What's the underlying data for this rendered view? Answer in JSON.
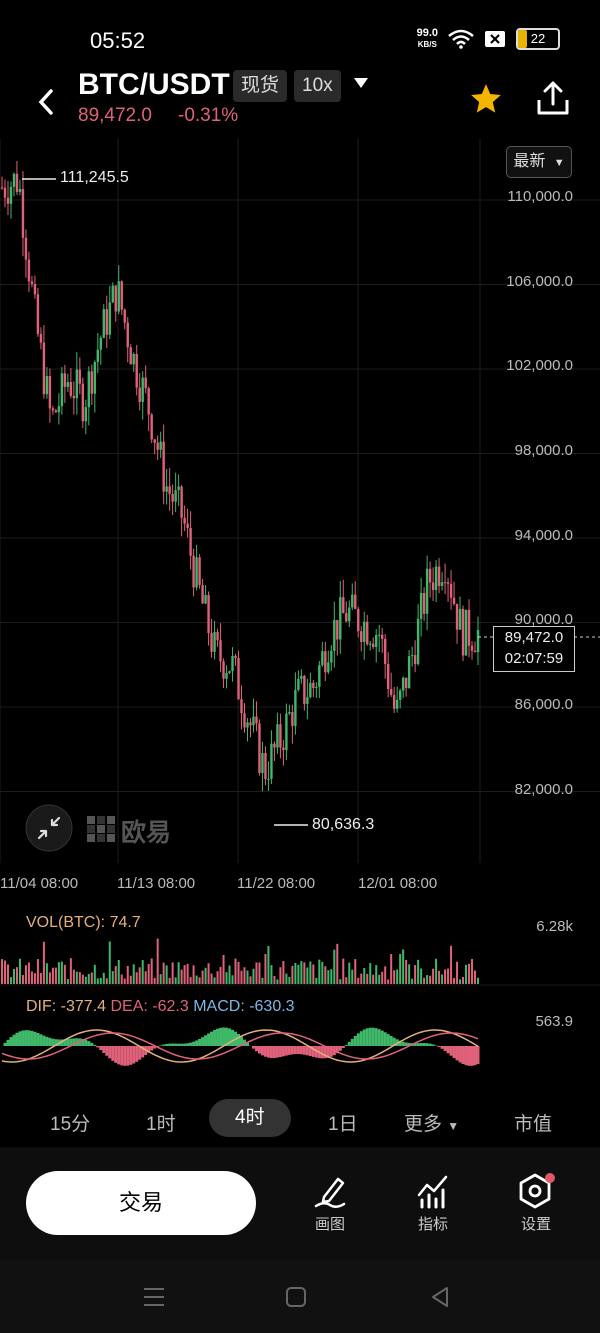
{
  "status_bar": {
    "time": "05:52",
    "net_speed_value": "99.0",
    "net_speed_unit": "KB/S",
    "battery": "22"
  },
  "header": {
    "pair": "BTC/USDT",
    "market_tag": "现货",
    "leverage_tag": "10x",
    "price": "89,472.0",
    "change": "-0.31%"
  },
  "chart": {
    "latest_button": "最新",
    "y_ticks": [
      "110,000.0",
      "106,000.0",
      "102,000.0",
      "98,000.0",
      "94,000.0",
      "90,000.0",
      "86,000.0",
      "82,000.0"
    ],
    "x_ticks": [
      "11/04 08:00",
      "11/13 08:00",
      "11/22 08:00",
      "12/01 08:00"
    ],
    "high_label": "111,245.5",
    "low_label": "80,636.3",
    "current_price": "89,472.0",
    "countdown": "02:07:59",
    "watermark": "欧易",
    "up_color": "#3fb86a",
    "down_color": "#e0627a"
  },
  "volume": {
    "title": "VOL(BTC): 74.7",
    "max_label": "6.28k"
  },
  "macd": {
    "dif": "DIF: -377.4",
    "dea": "DEA: -62.3",
    "macd": "MACD: -630.3",
    "max_label": "563.9"
  },
  "timeframes": {
    "items": [
      "15分",
      "1时",
      "4时",
      "1日",
      "更多"
    ],
    "active": "4时",
    "market_value": "市值"
  },
  "bottom_bar": {
    "trade": "交易",
    "draw": "画图",
    "indicators": "指标",
    "settings": "设置"
  },
  "chart_data": {
    "type": "candlestick",
    "x_ticks": [
      "11/04 08:00",
      "11/13 08:00",
      "11/22 08:00",
      "12/01 08:00"
    ],
    "ylim": [
      80000,
      112000
    ],
    "y_ticks": [
      82000,
      86000,
      90000,
      94000,
      98000,
      102000,
      106000,
      110000
    ],
    "high": 111245.5,
    "low": 80636.3,
    "last": 89472.0,
    "close_path": [
      110600,
      111000,
      104500,
      99500,
      101500,
      100500,
      103500,
      105800,
      102500,
      100000,
      96500,
      95000,
      91500,
      88500,
      88000,
      85500,
      83000,
      84500,
      86500,
      87000,
      89500,
      90500,
      90000,
      89500,
      85500,
      88500,
      92000,
      93000,
      89500,
      89500
    ],
    "volume_max": "6.28k",
    "volume_last": 74.7,
    "macd_max": 563.9,
    "dif": -377.4,
    "dea": -62.3,
    "macd": -630.3
  }
}
